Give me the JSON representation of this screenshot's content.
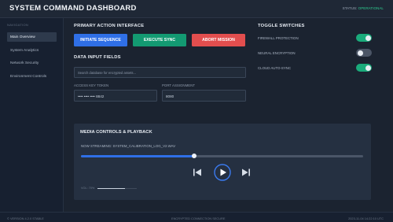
{
  "header": {
    "title": "SYSTEM COMMAND DASHBOARD",
    "status_label": "STATUS:",
    "status_value": "OPERATIONAL"
  },
  "sidebar": {
    "title": "NAVIGATION",
    "items": [
      {
        "label": "Main Overview",
        "active": true
      },
      {
        "label": "System Analytics",
        "active": false
      },
      {
        "label": "Network Security",
        "active": false
      },
      {
        "label": "Environment Controls",
        "active": false
      }
    ]
  },
  "actions": {
    "title": "PRIMARY ACTION INTERFACE",
    "initiate_label": "INITIATE SEQUENCE",
    "sync_label": "EXECUTE SYNC",
    "abort_label": "ABORT MISSION"
  },
  "inputs": {
    "title": "DATA INPUT FIELDS",
    "search_placeholder": "Search database for encrypted assets...",
    "access_key_label": "ACCESS KEY TOKEN",
    "access_key_value": "•••• •••• •••• 8842",
    "port_label": "PORT ASSIGNMENT",
    "port_value": "8080"
  },
  "toggles": {
    "title": "TOGGLE SWITCHES",
    "items": [
      {
        "label": "FIREWALL PROTECTION",
        "on": true
      },
      {
        "label": "NEURAL ENCRYPTION",
        "on": false
      },
      {
        "label": "CLOUD AUTO-SYNC",
        "on": true
      }
    ]
  },
  "media": {
    "title": "MEDIA CONTROLS & PLAYBACK",
    "now_streaming": "NOW STREAMING: SYSTEM_CALIBRATION_LOG_V2.WAV",
    "progress": 0.4,
    "volume_label": "VOL: 70%",
    "volume": 0.7
  },
  "footer": {
    "version": "© VERSION 4.2.0 STABLE",
    "connection": "ENCRYPTED CONNECTION SECURE",
    "timestamp": "2023-11-04 14:22:10 UTC"
  },
  "colors": {
    "accent_blue": "#2f6fe6",
    "accent_green": "#139a72",
    "accent_red": "#e24e4e",
    "status_ok": "#2ec98f"
  }
}
